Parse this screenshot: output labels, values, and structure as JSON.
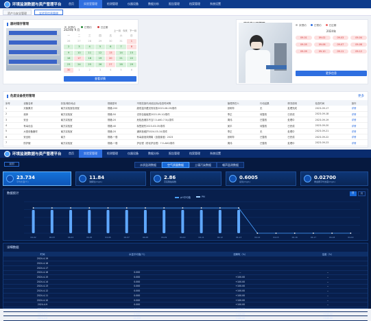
{
  "app": {
    "title": "环境监测数据与资产管理平台"
  },
  "nav": [
    "首页",
    "实验室管理",
    "检测管理",
    "仪器设备",
    "数据分析",
    "报告管理",
    "档案管理",
    "系统设置"
  ],
  "tabs": [
    "资产与安全管理",
    "实验室信息管理"
  ],
  "p1": {
    "title": "器材储存管理"
  },
  "cal": {
    "month": "2024年 9 月",
    "prev": "上一月",
    "today": "今天",
    "next": "下一月",
    "weekdays": [
      "一",
      "二",
      "三",
      "四",
      "五",
      "六",
      "日"
    ],
    "days": [
      {
        "n": "26",
        "s": "o"
      },
      {
        "n": "27",
        "s": "o"
      },
      {
        "n": "28",
        "s": "o"
      },
      {
        "n": "29",
        "s": "o"
      },
      {
        "n": "30",
        "s": "o"
      },
      {
        "n": "31",
        "s": "o"
      },
      {
        "n": "1",
        "s": "r"
      },
      {
        "n": "2",
        "s": "g"
      },
      {
        "n": "3",
        "s": "g"
      },
      {
        "n": "4",
        "s": "g"
      },
      {
        "n": "5",
        "s": "g"
      },
      {
        "n": "6",
        "s": "g"
      },
      {
        "n": "7",
        "s": "g"
      },
      {
        "n": "8",
        "s": "r"
      },
      {
        "n": "9",
        "s": "g"
      },
      {
        "n": "10",
        "s": "g"
      },
      {
        "n": "11",
        "s": "g"
      },
      {
        "n": "12",
        "s": "g"
      },
      {
        "n": "13",
        "s": "r"
      },
      {
        "n": "14",
        "s": "g"
      },
      {
        "n": "15",
        "s": "g"
      },
      {
        "n": "16",
        "s": "g"
      },
      {
        "n": "17",
        "s": "r"
      },
      {
        "n": "18",
        "s": "g"
      },
      {
        "n": "19",
        "s": "g"
      },
      {
        "n": "20",
        "s": "r"
      },
      {
        "n": "21",
        "s": "g"
      },
      {
        "n": "22",
        "s": "g"
      },
      {
        "n": "23",
        "s": "g"
      },
      {
        "n": "24",
        "s": "g"
      },
      {
        "n": "25",
        "s": "g"
      },
      {
        "n": "26",
        "s": "g"
      },
      {
        "n": "27",
        "s": "r"
      },
      {
        "n": "28",
        "s": "g"
      },
      {
        "n": "29",
        "s": "g"
      },
      {
        "n": "30",
        "s": "r"
      },
      {
        "n": "1",
        "s": "o"
      },
      {
        "n": "2",
        "s": "o"
      },
      {
        "n": "3",
        "s": "o"
      },
      {
        "n": "4",
        "s": "o"
      },
      {
        "n": "5",
        "s": "o"
      },
      {
        "n": "6",
        "s": "o"
      }
    ],
    "button": "查看详情",
    "legend": [
      "未预约",
      "已预约",
      "已过期"
    ]
  },
  "p2": {
    "title": "实验室仪器管理",
    "legend": [
      "未预约",
      "已预约",
      "已过期"
    ],
    "month": "2024年",
    "pills": [
      "09-01",
      "09-02",
      "09-03",
      "09-04",
      "09-05",
      "09-06",
      "09-07",
      "09-08",
      "09-09",
      "09-10",
      "09-11",
      "09-12"
    ],
    "button": "更多信息"
  },
  "list": {
    "title": "危废设备使用管理",
    "more": "更多",
    "headers": [
      "序号",
      "设备名称",
      "存放/储存地点",
      "规格型号",
      "不规范操作/危险目标/检查时间等",
      "管理责任人",
      "行动结果",
      "情况说明",
      "检查时间",
      "操作"
    ],
    "rows": [
      [
        "1",
        "天聚果冻",
        "南方实验室检测室",
        "规格:200",
        "超低温冷藏试剂存放2023-08-09/零件",
        "张明华",
        "无",
        "处理完成",
        "2023-09-17",
        "详情"
      ],
      [
        "2",
        "液体",
        "南方实验室",
        "规格:50",
        "试剂包装破损2023-09-10/零件",
        "李正",
        "待整改",
        "已完成",
        "2023-09-18",
        "详情"
      ],
      [
        "3",
        "安全",
        "南方实验室",
        "规格:20",
        "危险品储存不当7.5-A60-7.5以零件",
        "周伟",
        "已整改",
        "处理中",
        "2023-09-19",
        "详情"
      ],
      [
        "4",
        "有毒化合",
        "南方实验室",
        "规格:40",
        "标签缺失2023-03-05/零件",
        "吴平",
        "待整改",
        "已完成",
        "2023-09-20",
        "详情"
      ],
      [
        "5",
        "大型设备器材",
        "南方实验室",
        "规格:20",
        "通风柜维护2024-03-10/零件",
        "李正",
        "无",
        "处理中",
        "2023-09-21",
        "详情"
      ],
      [
        "6",
        "安全柜",
        "南方",
        "规格:一般",
        "有毒废液未隔离（含铬废液）2023",
        "张明华",
        "已整改",
        "已完成",
        "2023-09-22",
        "详情"
      ],
      [
        "7",
        "防护服",
        "南方实验室",
        "规格:一般",
        "护目镜（防化护目镜）7.5-A60/零件",
        "周伟",
        "已整改",
        "处理中",
        "2023-09-23",
        "详情"
      ]
    ]
  },
  "dark": {
    "title": "环境监测数据与资产管理平台",
    "nav": [
      "首页",
      "实验室管理",
      "检测管理",
      "仪器设备",
      "数据分析",
      "报告管理",
      "档案管理",
      "系统设置"
    ],
    "back": "返回",
    "tabs": [
      "水质监测数据",
      "空气质量数据",
      "土壤污染数据",
      "噪声监测数据"
    ],
    "stats": [
      {
        "v": "23.734",
        "l": "平均水温(℃)"
      },
      {
        "v": "11.84",
        "l": "溶解氧(mg/L)"
      },
      {
        "v": "2.86",
        "l": "高锰酸盐指数"
      },
      {
        "v": "0.6005",
        "l": "总氮(mg/L)"
      },
      {
        "v": "0.02700",
        "l": "重金属平均浓度(mg/L)"
      }
    ],
    "chart_title": "数据统计",
    "chart_toggle": [
      "日",
      "月"
    ],
    "legend": [
      "pH平均值",
      "PM"
    ],
    "table_title": "详细数据",
    "table_headers": [
      "时间",
      "水温平均值(℃)",
      "溶解氧（%）",
      "浊度（%）"
    ],
    "table_rows": [
      [
        "2024-4-19",
        "",
        "",
        ""
      ],
      [
        "2024-4-18",
        "",
        "",
        ""
      ],
      [
        "2024-4-17",
        "",
        "",
        ""
      ],
      [
        "2024-4-16",
        "0.000",
        "--",
        "--"
      ],
      [
        "2024-4-15",
        "0.000",
        "+100.00",
        "--"
      ],
      [
        "2024-4-14",
        "0.000",
        "+100.00",
        "--"
      ],
      [
        "2024-4-13",
        "0.000",
        "+100.00",
        "--"
      ],
      [
        "2024-4-12",
        "0.000",
        "+100.00",
        "--"
      ],
      [
        "2024-4-11",
        "0.000",
        "+100.00",
        "--"
      ],
      [
        "2024-4-10",
        "0.000",
        "+100.00",
        "--"
      ],
      [
        "2024-4-9",
        "0.000",
        "+100.00",
        "--"
      ],
      [
        "2024-4-8",
        "0.000",
        "+100.00",
        "--"
      ],
      [
        "2024-4-7",
        "0.000",
        "+100.00",
        "+100.00"
      ],
      [
        "2024-4-6",
        "10.000",
        "+100.00",
        "+100.00"
      ]
    ]
  },
  "chart_data": {
    "type": "bar",
    "categories": [
      "04-02",
      "04-03",
      "04-04",
      "04-05",
      "04-06",
      "04-07",
      "04-08",
      "04-09",
      "04-10",
      "04-11",
      "04-12",
      "04-13",
      "04-14",
      "04-15",
      "04-16",
      "04-17",
      "04-18",
      "04-19"
    ],
    "series": [
      {
        "name": "pH平均值",
        "values": [
          7.4,
          7.4,
          7.4,
          7.4,
          7.4,
          7.4,
          7.4,
          7.4,
          7.4,
          7.4,
          7.4,
          7.4,
          0,
          0,
          0,
          0,
          0,
          0
        ]
      },
      {
        "name": "PM",
        "values": [
          8,
          8,
          8,
          8,
          8,
          8,
          8,
          8,
          8,
          8,
          8,
          8,
          0,
          0,
          0,
          0,
          0,
          0
        ]
      }
    ],
    "ylim": [
      0,
      10
    ],
    "line_color": "#4aa0ff",
    "bar_color": "#5fa8ff"
  }
}
